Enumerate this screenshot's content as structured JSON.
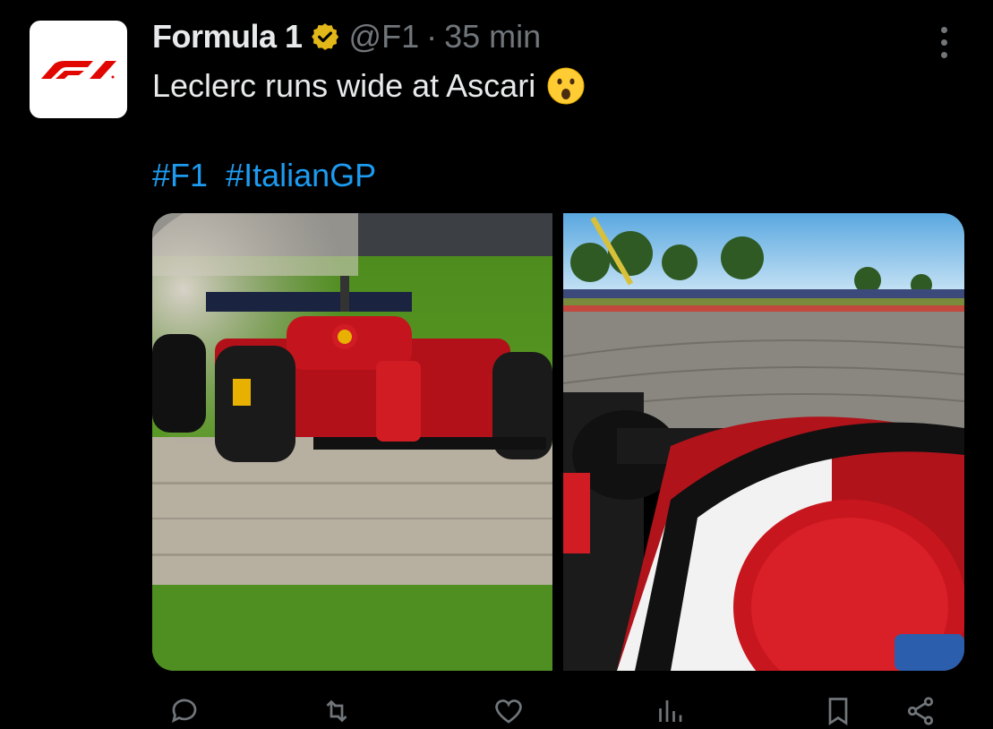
{
  "account": {
    "name": "Formula 1",
    "handle": "@F1",
    "separator": "·",
    "time": "35 min",
    "avatar_icon": "f1-logo",
    "verified_color": "#e2b719"
  },
  "tweet": {
    "text": "Leclerc runs wide at Ascari",
    "emoji": "😮",
    "hashtags": [
      "#F1",
      "#ItalianGP"
    ]
  },
  "media": [
    {
      "name": "leclerc-gravel-photo",
      "description": "Ferrari car kicking up dust in gravel trap"
    },
    {
      "name": "onboard-camera-photo",
      "description": "Onboard view from Ferrari cockpit"
    }
  ],
  "actions": {
    "reply_icon": "reply-icon",
    "reply_count": "",
    "retweet_icon": "retweet-icon",
    "retweet_count": "",
    "like_icon": "heart-icon",
    "like_count": "",
    "views_icon": "views-icon",
    "views_count": "",
    "bookmark_icon": "bookmark-icon",
    "share_icon": "share-icon"
  },
  "colors": {
    "background": "#000000",
    "text": "#e7e9ea",
    "muted": "#71767b",
    "link": "#1d9bf0",
    "f1_red": "#e10600"
  }
}
